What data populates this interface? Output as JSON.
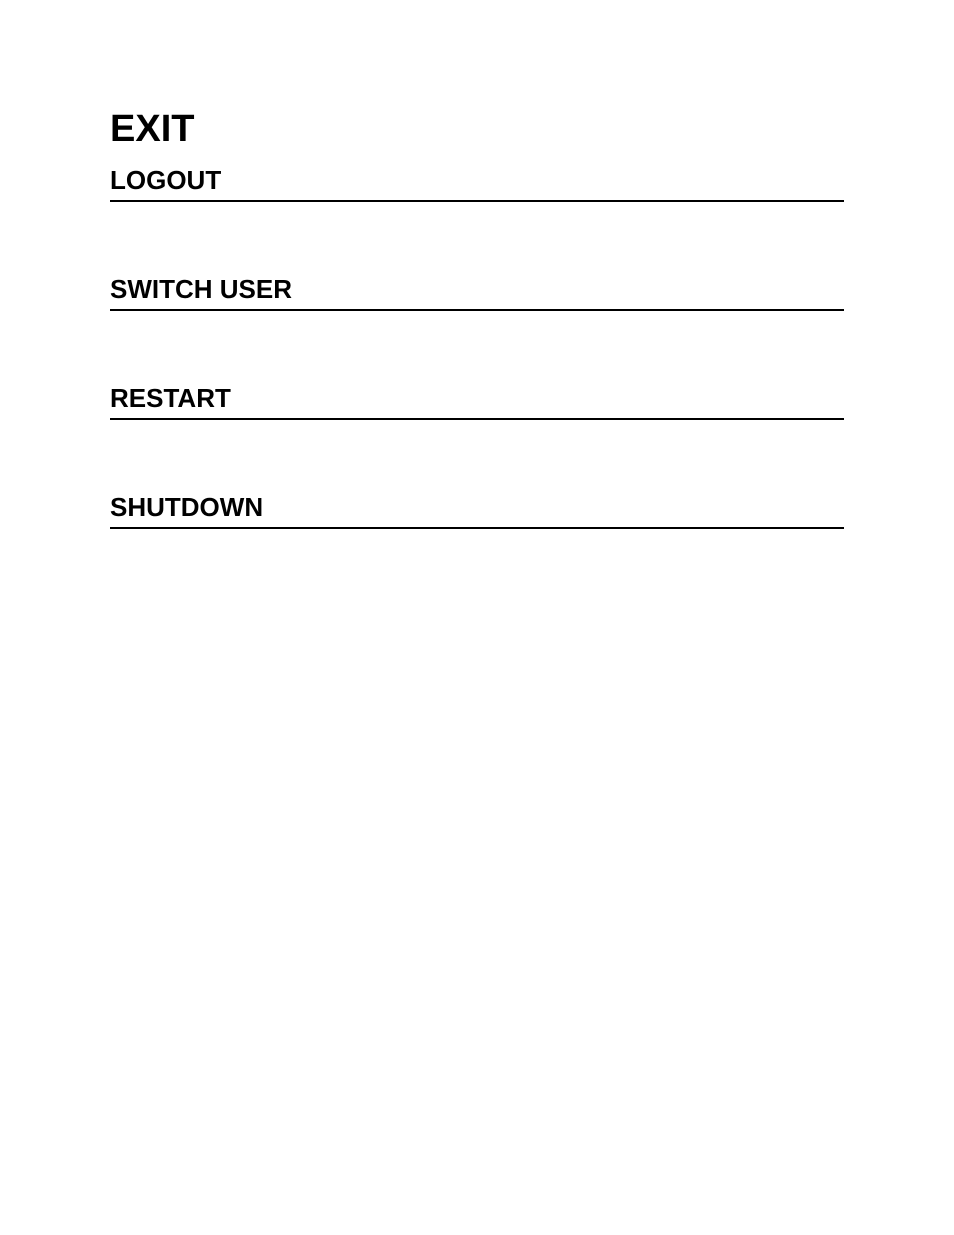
{
  "title": "EXIT",
  "menu": {
    "items": [
      {
        "label": "LOGOUT"
      },
      {
        "label": "SWITCH USER"
      },
      {
        "label": "RESTART"
      },
      {
        "label": "SHUTDOWN"
      }
    ]
  }
}
